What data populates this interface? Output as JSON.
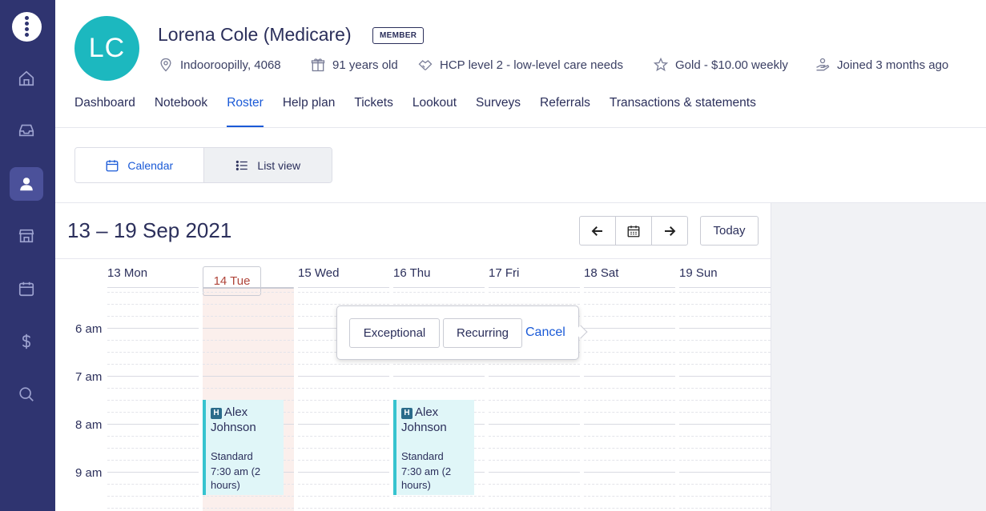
{
  "sidebar": {
    "items": [
      {
        "icon": "home-icon"
      },
      {
        "icon": "inbox-icon"
      },
      {
        "icon": "person-icon",
        "active": true
      },
      {
        "icon": "store-icon"
      },
      {
        "icon": "calendar-icon"
      },
      {
        "icon": "dollar-icon"
      },
      {
        "icon": "search-icon"
      }
    ]
  },
  "profile": {
    "initials": "LC",
    "name": "Lorena Cole (Medicare)",
    "badge": "MEMBER",
    "location": "Indooroopilly, 4068",
    "age": "91 years old",
    "care_level": "HCP level 2 - low-level care needs",
    "plan": "Gold - $10.00 weekly",
    "joined": "Joined 3 months ago"
  },
  "tabs": [
    {
      "label": "Dashboard"
    },
    {
      "label": "Notebook"
    },
    {
      "label": "Roster",
      "active": true
    },
    {
      "label": "Help plan"
    },
    {
      "label": "Tickets"
    },
    {
      "label": "Lookout"
    },
    {
      "label": "Surveys"
    },
    {
      "label": "Referrals"
    },
    {
      "label": "Transactions & statements"
    }
  ],
  "view_toggle": {
    "calendar_label": "Calendar",
    "list_label": "List view",
    "selected": "Calendar"
  },
  "calendar": {
    "range": "13 – 19 Sep 2021",
    "today_label": "Today",
    "days": [
      "13 Mon",
      "14 Tue",
      "15 Wed",
      "16 Thu",
      "17 Fri",
      "18 Sat",
      "19 Sun"
    ],
    "today_day": "14 Tue",
    "times": [
      "6 am",
      "7 am",
      "8 am",
      "9 am"
    ],
    "events": [
      {
        "badge": "H",
        "name": "Alex Johnson",
        "type": "Standard",
        "time": "7:30 am (2 hours)"
      },
      {
        "badge": "H",
        "name": "Alex Johnson",
        "type": "Standard",
        "time": "7:30 am (2 hours)"
      }
    ]
  },
  "popover": {
    "exceptional_label": "Exceptional",
    "recurring_label": "Recurring",
    "cancel_label": "Cancel"
  },
  "colors": {
    "sidebar": "#2f3470",
    "accent": "#1a5ad7",
    "avatar": "#1cb8bf",
    "today": "#b0453a",
    "event": "#36c3cf"
  }
}
